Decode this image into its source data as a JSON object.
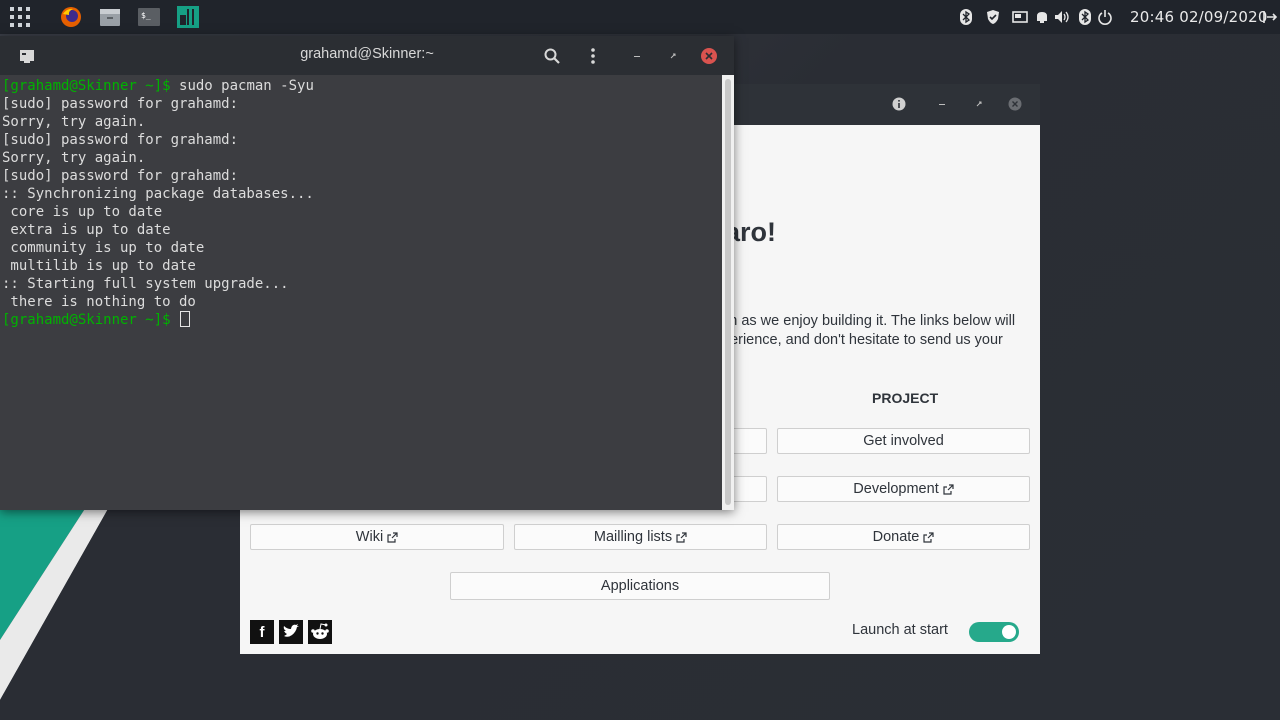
{
  "panel": {
    "clock": "20:46 02/09/2020",
    "launchers": [
      "apps-grid",
      "firefox",
      "file-manager",
      "terminal",
      "manjaro"
    ],
    "tray_icons": [
      "bluetooth",
      "shield",
      "display",
      "notifications",
      "volume",
      "bluetooth",
      "power",
      "logout"
    ]
  },
  "terminal": {
    "title": "grahamd@Skinner:~",
    "lines": [
      {
        "prompt": "[grahamd@Skinner ~]$ ",
        "text": "sudo pacman -Syu"
      },
      {
        "prompt": "",
        "text": "[sudo] password for grahamd:"
      },
      {
        "prompt": "",
        "text": "Sorry, try again."
      },
      {
        "prompt": "",
        "text": "[sudo] password for grahamd:"
      },
      {
        "prompt": "",
        "text": "Sorry, try again."
      },
      {
        "prompt": "",
        "text": "[sudo] password for grahamd:"
      },
      {
        "prompt": "",
        "text": ":: Synchronizing package databases..."
      },
      {
        "prompt": "",
        "text": " core is up to date"
      },
      {
        "prompt": "",
        "text": " extra is up to date"
      },
      {
        "prompt": "",
        "text": " community is up to date"
      },
      {
        "prompt": "",
        "text": " multilib is up to date"
      },
      {
        "prompt": "",
        "text": ":: Starting full system upgrade..."
      },
      {
        "prompt": "",
        "text": " there is nothing to do"
      },
      {
        "prompt": "[grahamd@Skinner ~]$ ",
        "text": ""
      }
    ]
  },
  "welcome": {
    "heading": "aro!",
    "para": [
      "ch as we enjoy building it. The links below will",
      "perience, and don't hesitate to send us your"
    ],
    "column_project": "PROJECT",
    "buttons": {
      "get_involved": "Get involved",
      "development": "Development",
      "wiki": "Wiki",
      "mailing_lists": "Mailling lists",
      "donate": "Donate",
      "applications": "Applications"
    },
    "launch_at_start": "Launch at start",
    "launch_at_start_on": true,
    "social": [
      "f",
      "twitter",
      "reddit"
    ]
  },
  "colors": {
    "accent": "#16a085",
    "toggle": "#26a98b",
    "prompt": "#00b300",
    "close": "#d9534f"
  }
}
